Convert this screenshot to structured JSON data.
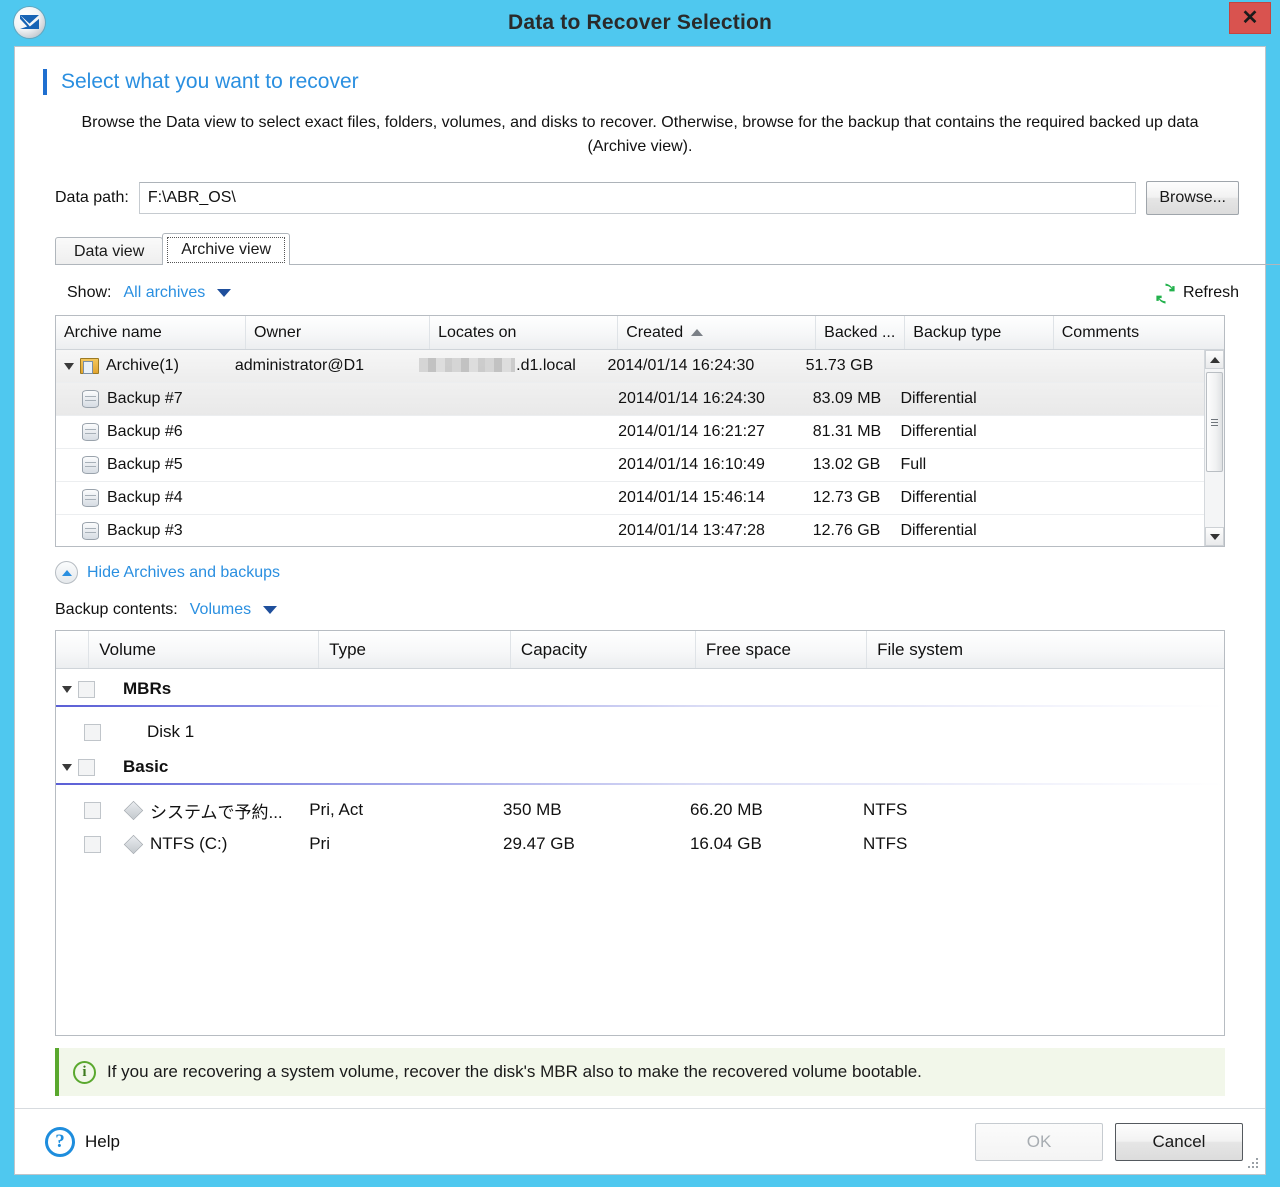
{
  "window": {
    "title": "Data to Recover Selection",
    "app_icon": "acronis-logo-icon",
    "close_label": "✕",
    "titlebar_color": "#4fc8ef",
    "close_button_color": "#d9534f"
  },
  "heading": {
    "text": "Select what you want to recover",
    "accent_color": "#2a8fe0"
  },
  "description": "Browse the Data view to select exact files, folders, volumes, and disks to recover. Otherwise, browse for the backup that contains the required backed up data (Archive view).",
  "data_path": {
    "label": "Data path:",
    "value": "F:\\ABR_OS\\",
    "placeholder": "",
    "browse_label": "Browse..."
  },
  "tabs": [
    {
      "label": "Data view",
      "active": false
    },
    {
      "label": "Archive view",
      "active": true
    }
  ],
  "show": {
    "label": "Show:",
    "value": "All archives",
    "caret_icon": "chevron-down-icon"
  },
  "refresh": {
    "label": "Refresh",
    "icon": "refresh-icon",
    "color": "#22b14c"
  },
  "archive_table": {
    "columns": [
      "Archive name",
      "Owner",
      "Locates on",
      "Created",
      "Backed ...",
      "Backup type",
      "Comments"
    ],
    "sort_column": "Created",
    "sort_direction": "ascending",
    "rows": [
      {
        "kind": "archive",
        "icon": "archive-folder-icon",
        "name": "Archive(1)",
        "owner": "administrator@D1",
        "locates_on": ".d1.local",
        "locates_on_redacted": true,
        "created": "2014/01/14 16:24:30",
        "backed_up": "51.73 GB",
        "backup_type": "",
        "comments": "",
        "selected": false,
        "expanded": true
      },
      {
        "kind": "backup",
        "icon": "backup-disk-icon",
        "name": "Backup #7",
        "owner": "",
        "locates_on": "",
        "created": "2014/01/14 16:24:30",
        "backed_up": "83.09 MB",
        "backup_type": "Differential",
        "comments": "",
        "selected": true
      },
      {
        "kind": "backup",
        "icon": "backup-disk-icon",
        "name": "Backup #6",
        "owner": "",
        "locates_on": "",
        "created": "2014/01/14 16:21:27",
        "backed_up": "81.31 MB",
        "backup_type": "Differential",
        "comments": "",
        "selected": false
      },
      {
        "kind": "backup",
        "icon": "backup-disk-icon",
        "name": "Backup #5",
        "owner": "",
        "locates_on": "",
        "created": "2014/01/14 16:10:49",
        "backed_up": "13.02 GB",
        "backup_type": "Full",
        "comments": "",
        "selected": false
      },
      {
        "kind": "backup",
        "icon": "backup-disk-icon",
        "name": "Backup #4",
        "owner": "",
        "locates_on": "",
        "created": "2014/01/14 15:46:14",
        "backed_up": "12.73 GB",
        "backup_type": "Differential",
        "comments": "",
        "selected": false
      },
      {
        "kind": "backup",
        "icon": "backup-disk-icon",
        "name": "Backup #3",
        "owner": "",
        "locates_on": "",
        "created": "2014/01/14 13:47:28",
        "backed_up": "12.76 GB",
        "backup_type": "Differential",
        "comments": "",
        "selected": false
      }
    ]
  },
  "hide_archives": {
    "label": "Hide Archives and backups",
    "icon": "chevron-up-circle-icon"
  },
  "backup_contents": {
    "label": "Backup contents:",
    "value": "Volumes",
    "caret_icon": "chevron-down-icon"
  },
  "volume_table": {
    "columns": [
      "Volume",
      "Type",
      "Capacity",
      "Free space",
      "File system"
    ],
    "rows": [
      {
        "kind": "group",
        "name": "MBRs",
        "checked": false,
        "expanded": true,
        "type": "",
        "capacity": "",
        "free_space": "",
        "file_system": ""
      },
      {
        "kind": "item",
        "name": "Disk 1",
        "checked": false,
        "has_volume_icon": false,
        "type": "",
        "capacity": "",
        "free_space": "",
        "file_system": ""
      },
      {
        "kind": "group",
        "name": "Basic",
        "checked": false,
        "expanded": true,
        "type": "",
        "capacity": "",
        "free_space": "",
        "file_system": ""
      },
      {
        "kind": "item",
        "name": "システムで予約...",
        "checked": false,
        "has_volume_icon": true,
        "type": "Pri, Act",
        "capacity": "350 MB",
        "free_space": "66.20 MB",
        "file_system": "NTFS"
      },
      {
        "kind": "item",
        "name": "NTFS (C:)",
        "checked": false,
        "has_volume_icon": true,
        "type": "Pri",
        "capacity": "29.47 GB",
        "free_space": "16.04 GB",
        "file_system": "NTFS"
      }
    ]
  },
  "info_banner": {
    "icon": "info-circle-icon",
    "text": "If you are recovering a system volume, recover the disk's MBR also to make the recovered volume bootable.",
    "accent_color": "#5aa82e"
  },
  "footer": {
    "help_label": "Help",
    "help_icon": "question-circle-icon",
    "ok_label": "OK",
    "ok_enabled": false,
    "cancel_label": "Cancel",
    "cancel_enabled": true,
    "resize_grip": "resize-grip-icon"
  }
}
